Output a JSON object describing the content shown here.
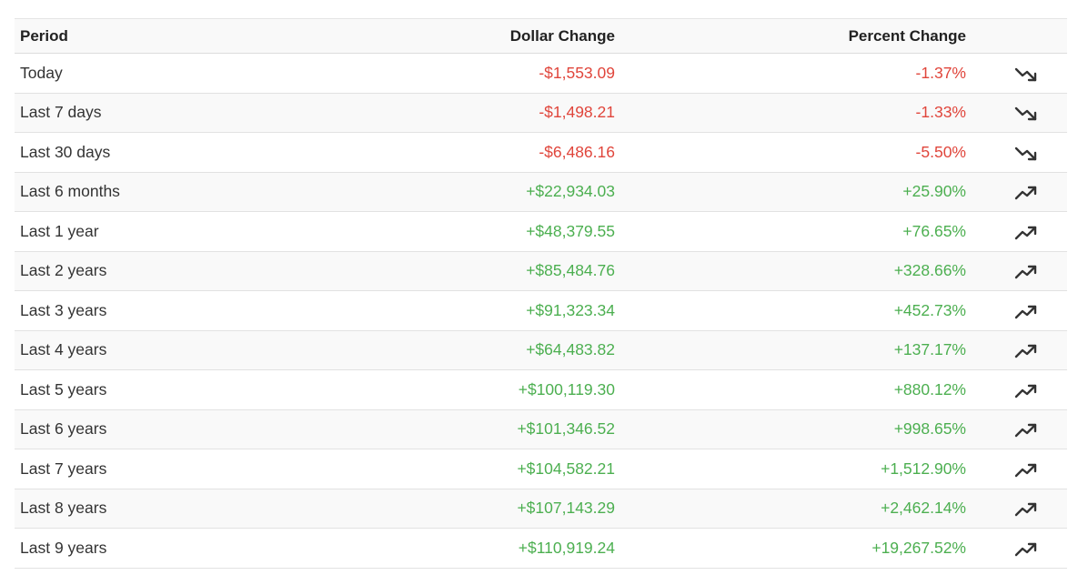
{
  "table": {
    "headers": {
      "period": "Period",
      "dollar": "Dollar Change",
      "percent": "Percent Change"
    },
    "colors": {
      "negative": "#e0453b",
      "positive": "#4caf50",
      "icon": "#333333"
    },
    "rows": [
      {
        "period": "Today",
        "dollar": "-$1,553.09",
        "percent": "-1.37%",
        "direction": "down",
        "icon": "trending-down-icon"
      },
      {
        "period": "Last 7 days",
        "dollar": "-$1,498.21",
        "percent": "-1.33%",
        "direction": "down",
        "icon": "trending-down-icon"
      },
      {
        "period": "Last 30 days",
        "dollar": "-$6,486.16",
        "percent": "-5.50%",
        "direction": "down",
        "icon": "trending-down-icon"
      },
      {
        "period": "Last 6 months",
        "dollar": "+$22,934.03",
        "percent": "+25.90%",
        "direction": "up",
        "icon": "trending-up-icon"
      },
      {
        "period": "Last 1 year",
        "dollar": "+$48,379.55",
        "percent": "+76.65%",
        "direction": "up",
        "icon": "trending-up-icon"
      },
      {
        "period": "Last 2 years",
        "dollar": "+$85,484.76",
        "percent": "+328.66%",
        "direction": "up",
        "icon": "trending-up-icon"
      },
      {
        "period": "Last 3 years",
        "dollar": "+$91,323.34",
        "percent": "+452.73%",
        "direction": "up",
        "icon": "trending-up-icon"
      },
      {
        "period": "Last 4 years",
        "dollar": "+$64,483.82",
        "percent": "+137.17%",
        "direction": "up",
        "icon": "trending-up-icon"
      },
      {
        "period": "Last 5 years",
        "dollar": "+$100,119.30",
        "percent": "+880.12%",
        "direction": "up",
        "icon": "trending-up-icon"
      },
      {
        "period": "Last 6 years",
        "dollar": "+$101,346.52",
        "percent": "+998.65%",
        "direction": "up",
        "icon": "trending-up-icon"
      },
      {
        "period": "Last 7 years",
        "dollar": "+$104,582.21",
        "percent": "+1,512.90%",
        "direction": "up",
        "icon": "trending-up-icon"
      },
      {
        "period": "Last 8 years",
        "dollar": "+$107,143.29",
        "percent": "+2,462.14%",
        "direction": "up",
        "icon": "trending-up-icon"
      },
      {
        "period": "Last 9 years",
        "dollar": "+$110,919.24",
        "percent": "+19,267.52%",
        "direction": "up",
        "icon": "trending-up-icon"
      }
    ]
  }
}
